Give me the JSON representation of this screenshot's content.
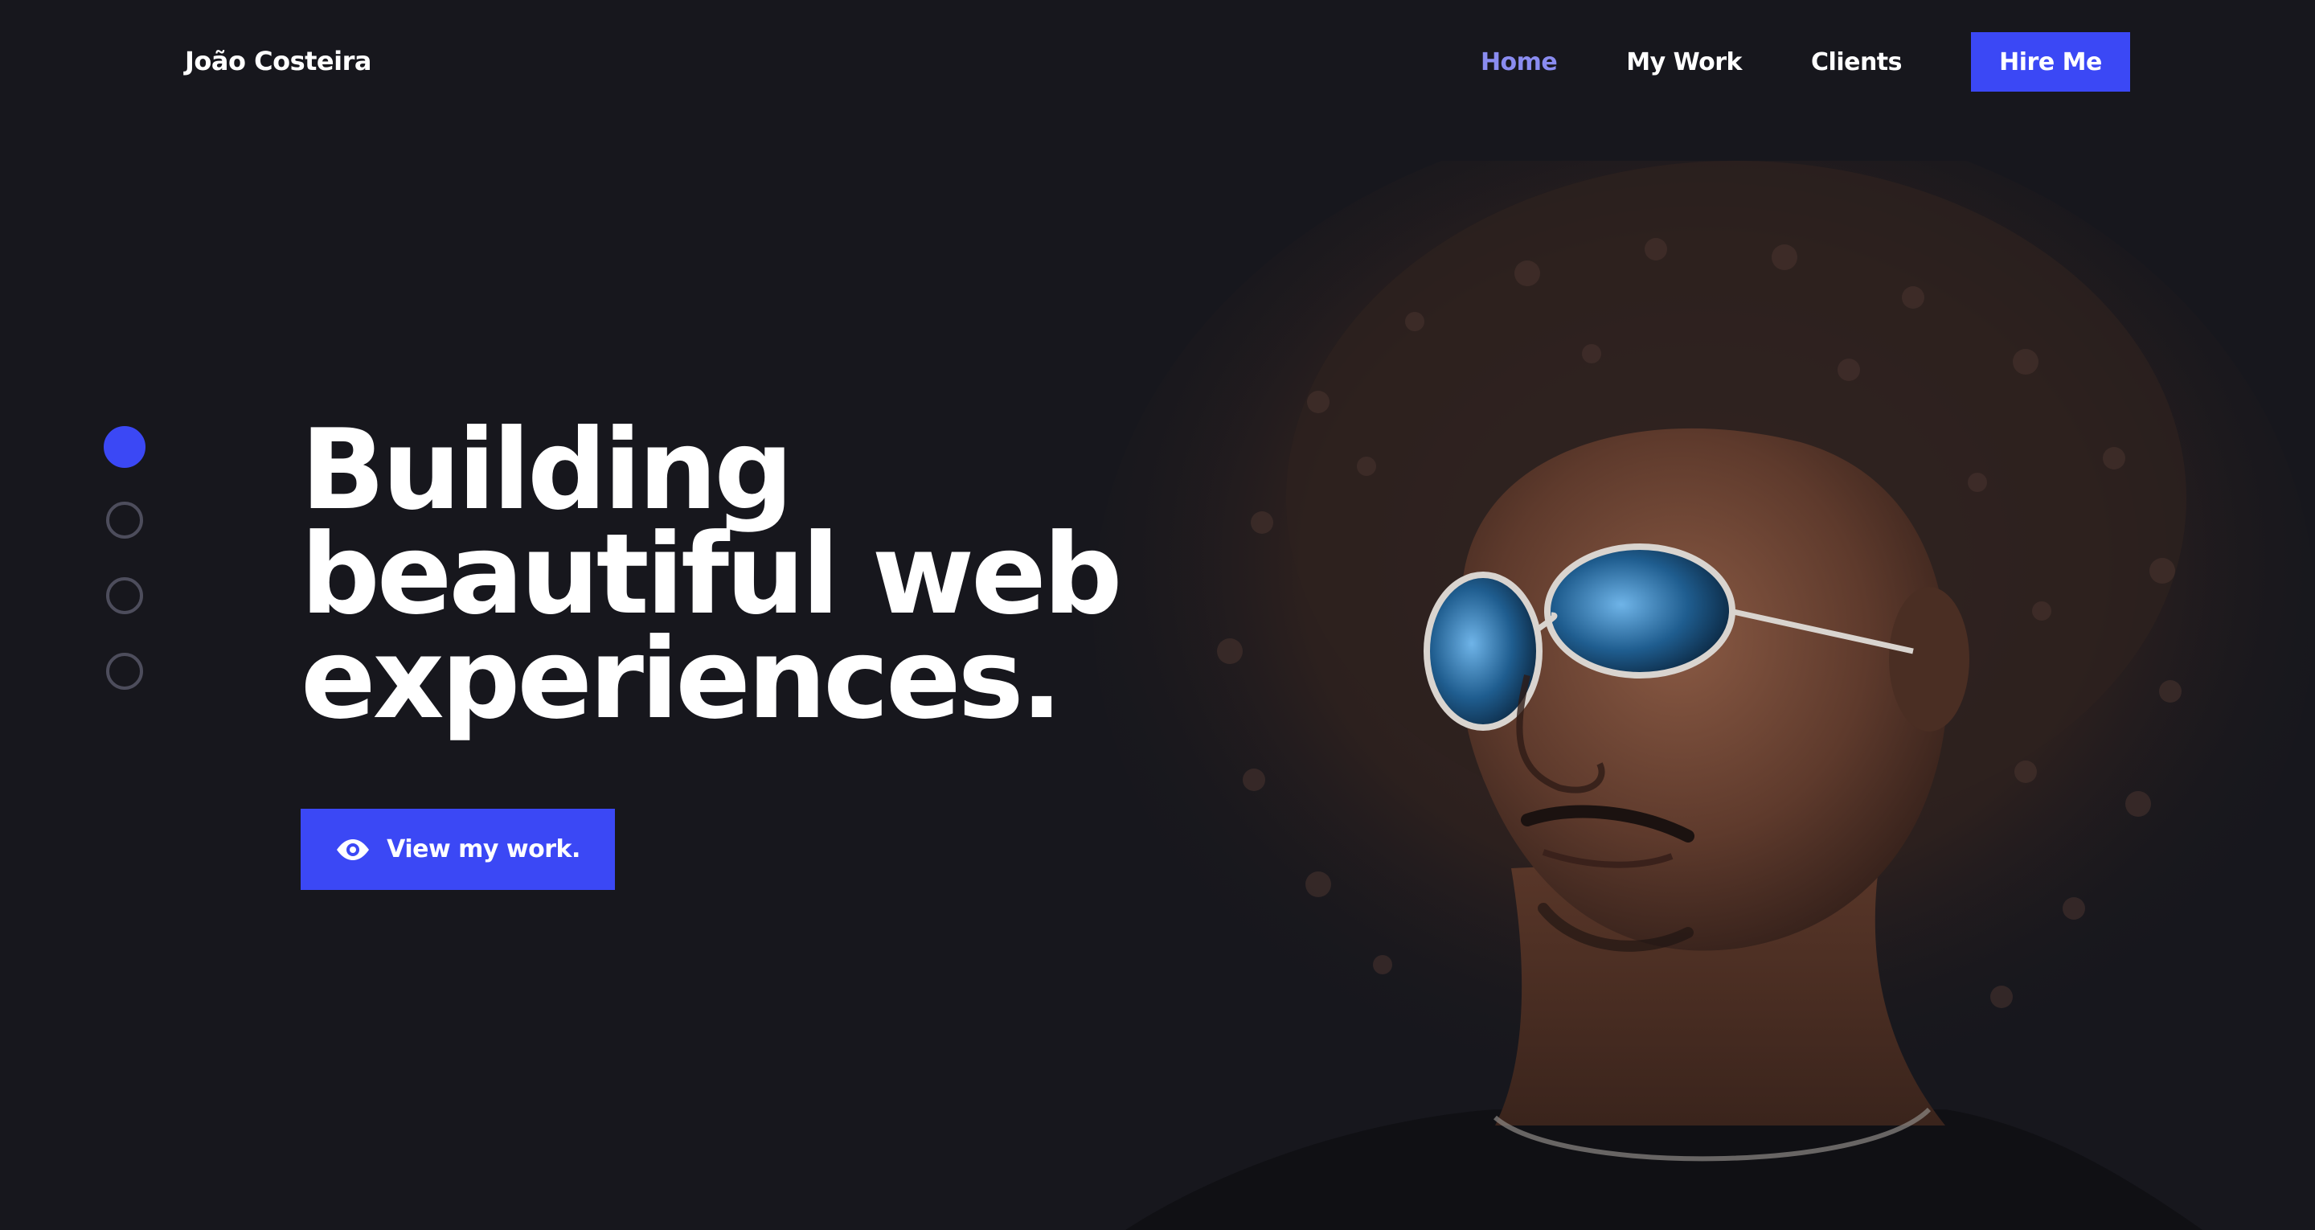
{
  "brand": {
    "name": "João Costeira"
  },
  "nav": {
    "items": [
      {
        "label": "Home",
        "active": true
      },
      {
        "label": "My Work",
        "active": false
      },
      {
        "label": "Clients",
        "active": false
      }
    ],
    "cta_label": "Hire Me"
  },
  "hero": {
    "headline_lines": [
      "Building",
      "beautiful web",
      "experiences."
    ],
    "cta_label": "View my work.",
    "cta_icon": "eye-icon",
    "slides": {
      "count": 4,
      "active_index": 0
    },
    "image": "portrait of a smiling man with curly hair and blue-tinted sunglasses"
  },
  "colors": {
    "background": "#17171d",
    "accent": "#3b48f5",
    "active_link": "#8a8cf0",
    "text": "#ffffff",
    "inactive_dot": "#4d4d5c"
  }
}
